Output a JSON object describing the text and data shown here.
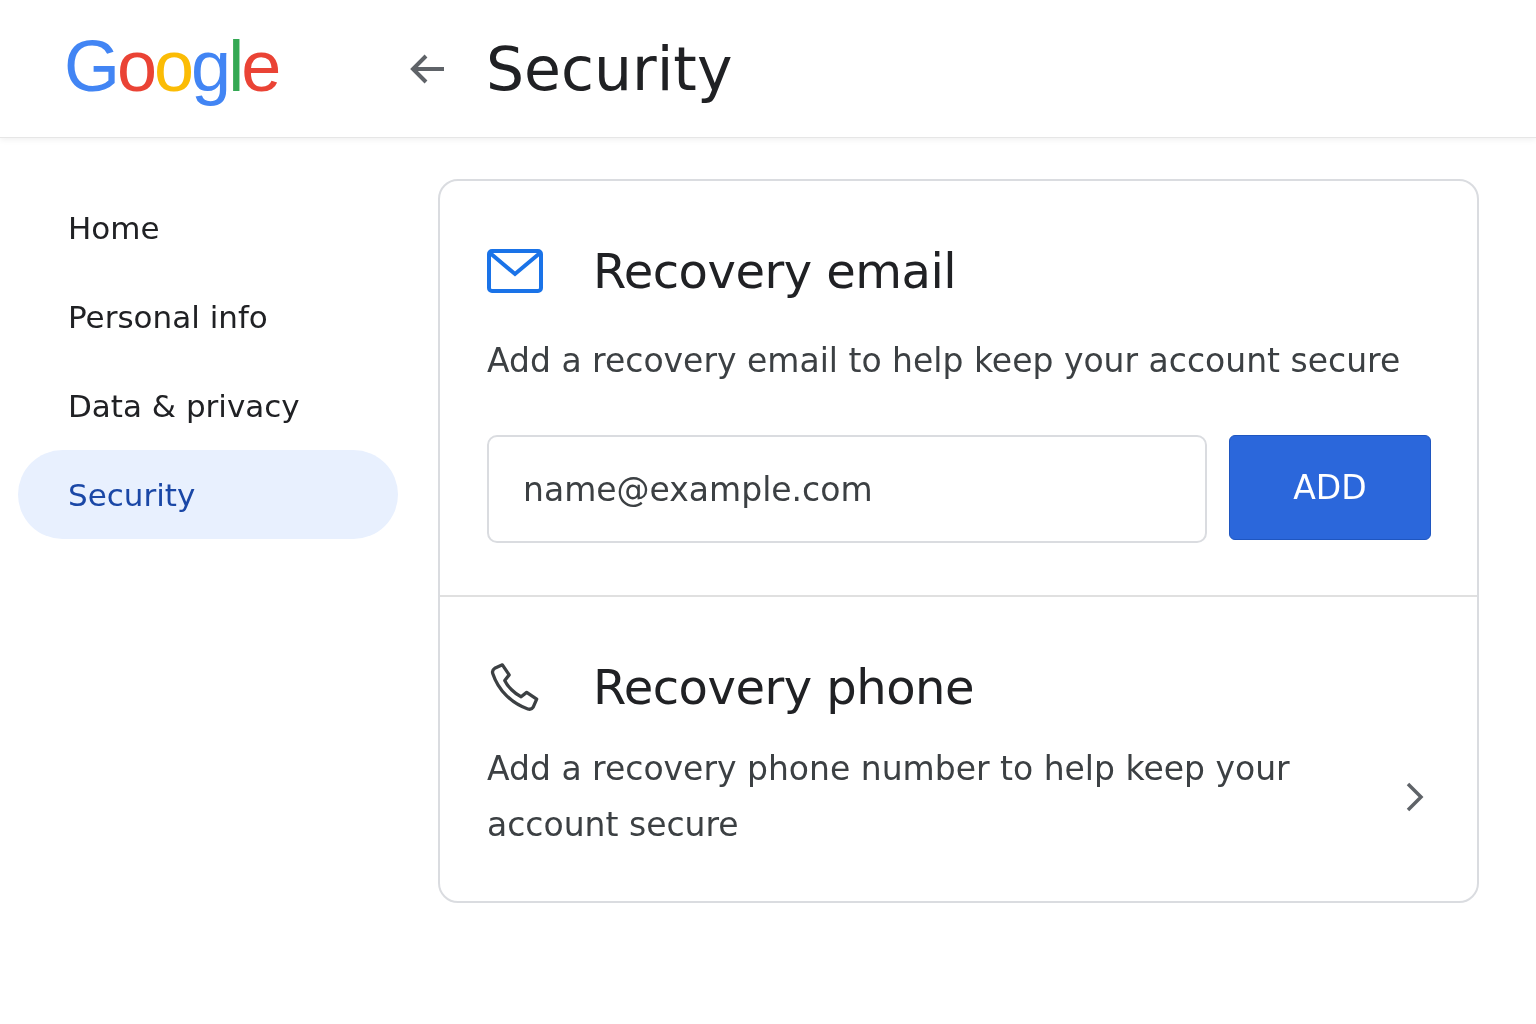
{
  "header": {
    "logo": "Google",
    "title": "Security"
  },
  "sidebar": {
    "items": [
      {
        "label": "Home",
        "selected": false
      },
      {
        "label": "Personal info",
        "selected": false
      },
      {
        "label": "Data & privacy",
        "selected": false
      },
      {
        "label": "Security",
        "selected": true
      }
    ]
  },
  "sections": [
    {
      "kind": "email",
      "title": "Recovery email",
      "description": "Add a recovery email to help keep your account secure",
      "field": {
        "placeholder": "name@example.com"
      },
      "button": "ADD"
    },
    {
      "kind": "phone",
      "title": "Recovery phone",
      "description": "Add a recovery phone number to help keep your account secure"
    }
  ]
}
